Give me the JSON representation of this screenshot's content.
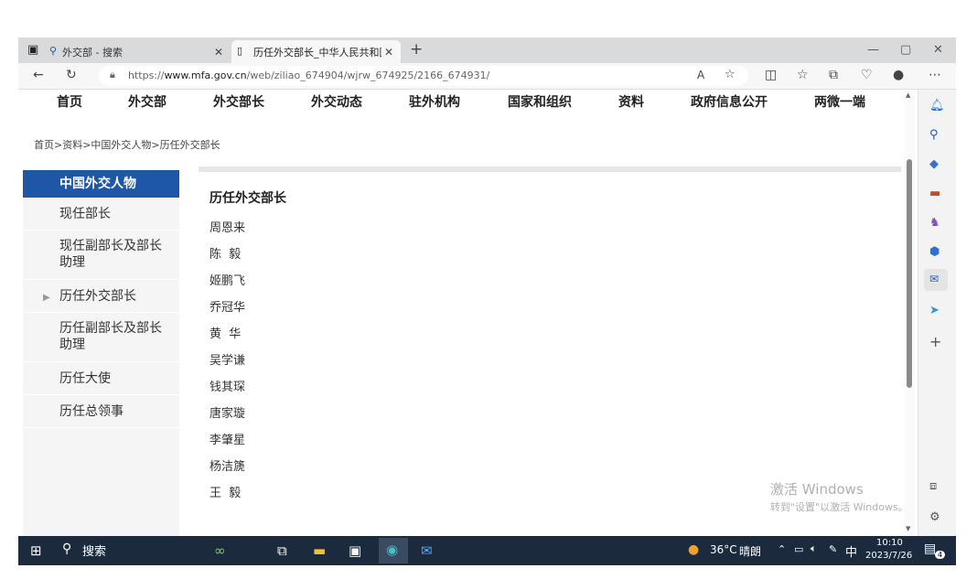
{
  "browser": {
    "tabs": [
      {
        "label": "外交部 - 搜索"
      },
      {
        "label": "历任外交部长_中华人民共和国外"
      }
    ],
    "url_prefix": "https://",
    "url_host": "www.mfa.gov.cn",
    "url_path": "/web/ziliao_674904/wjrw_674925/2166_674931/"
  },
  "nav": {
    "items": [
      "首页",
      "外交部",
      "外交部长",
      "外交动态",
      "驻外机构",
      "国家和组织",
      "资料",
      "政府信息公开",
      "两微一端"
    ]
  },
  "breadcrumb": "首页>资料>中国外交人物>历任外交部长",
  "sidebar": {
    "header": "中国外交人物",
    "items": [
      {
        "label": "现任部长"
      },
      {
        "label": "现任副部长及部长助理"
      },
      {
        "label": "历任外交部长"
      },
      {
        "label": "历任副部长及部长助理"
      },
      {
        "label": "历任大使"
      },
      {
        "label": "历任总领事"
      }
    ]
  },
  "content": {
    "title": "历任外交部长",
    "people": [
      "周恩来",
      "陈  毅",
      "姬鹏飞",
      "乔冠华",
      "黄  华",
      "吴学谦",
      "钱其琛",
      "唐家璇",
      "李肇星",
      "杨洁篪",
      "王  毅"
    ]
  },
  "watermark": {
    "line1": "激活 Windows",
    "line2": "转到\"设置\"以激活 Windows。"
  },
  "taskbar": {
    "search_label": "搜索",
    "weather_temp": "36°C",
    "weather_desc": "晴朗",
    "ime": "中",
    "time": "10:10",
    "date": "2023/7/26",
    "notification_count": "4"
  },
  "colors": {
    "accent": "#1f57a6",
    "taskbar": "#1c2a3d"
  }
}
